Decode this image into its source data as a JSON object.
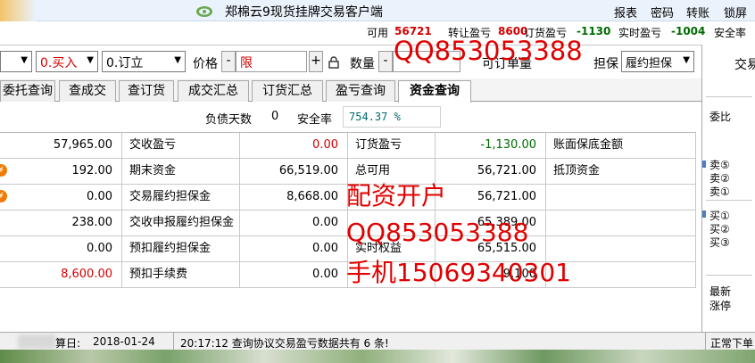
{
  "window": {
    "title": "郑棉云9现货挂牌交易客户端",
    "menu": [
      "报表",
      "密码",
      "转账",
      "锁屏"
    ]
  },
  "status": {
    "available_label": "可用",
    "available_value": "56721",
    "transfer_label": "转让盈亏",
    "transfer_value": "8600",
    "order_label": "订货盈亏",
    "order_value": "-1130",
    "realtime_label": "实时盈亏",
    "realtime_value": "-1004",
    "safety_label": "安全率"
  },
  "order": {
    "direction": "0.买入",
    "action": "0.订立",
    "price_label": "价格",
    "price_minus": "-",
    "price_value": "限",
    "price_plus": "+",
    "qty_label": "数量",
    "qty_minus": "-",
    "guarantee_label": "担保",
    "guarantee_value": "履约担保",
    "unit_text": "可订单量"
  },
  "watermarks": {
    "qq_top": "QQ853053388",
    "line1": "配资开户",
    "line2": "QQ853053388",
    "line3": "手机15069340301"
  },
  "tabs": [
    "委托查询",
    "查成交",
    "查订货",
    "成交汇总",
    "订货汇总",
    "盈亏查询",
    "资金查询"
  ],
  "info": {
    "debt_days_label": "负债天数",
    "debt_days_value": "0",
    "safety_rate_label": "安全率",
    "safety_rate_value": "754.37 %"
  },
  "grid": {
    "col1": [
      "57,965.00",
      "192.00",
      "0.00",
      "238.00",
      "0.00",
      "8,600.00"
    ],
    "col2_labels": [
      "交收盈亏",
      "期末资金",
      "交易履约担保金",
      "交收申报履约担保金",
      "预扣履约担保金",
      "预扣手续费"
    ],
    "col3": [
      "0.00",
      "66,519.00",
      "8,668.00",
      "0.00",
      "0.00",
      "0.00"
    ],
    "col4_labels": [
      "订货盈亏",
      "总可用",
      "",
      "",
      "实时权益",
      ""
    ],
    "col5": [
      "-1,130.00",
      "56,721.00",
      "56,721.00",
      "65,389.00",
      "65,515.00",
      "9,100"
    ],
    "col6_labels": [
      "账面保底金额",
      "抵顶资金",
      "",
      "",
      "",
      ""
    ]
  },
  "right_panel": {
    "title": "交易",
    "weibi": "委比",
    "sell": [
      "卖⑤",
      "卖②",
      "卖①"
    ],
    "buy": [
      "买①",
      "买②",
      "买③"
    ],
    "latest": "最新",
    "change": "涨停"
  },
  "bottom": {
    "settle_label": "算日:",
    "settle_date": "2018-01-24",
    "message": "20:17:12 查询协议交易盈亏数据共有 6 条!",
    "right_text": "正常下单"
  }
}
